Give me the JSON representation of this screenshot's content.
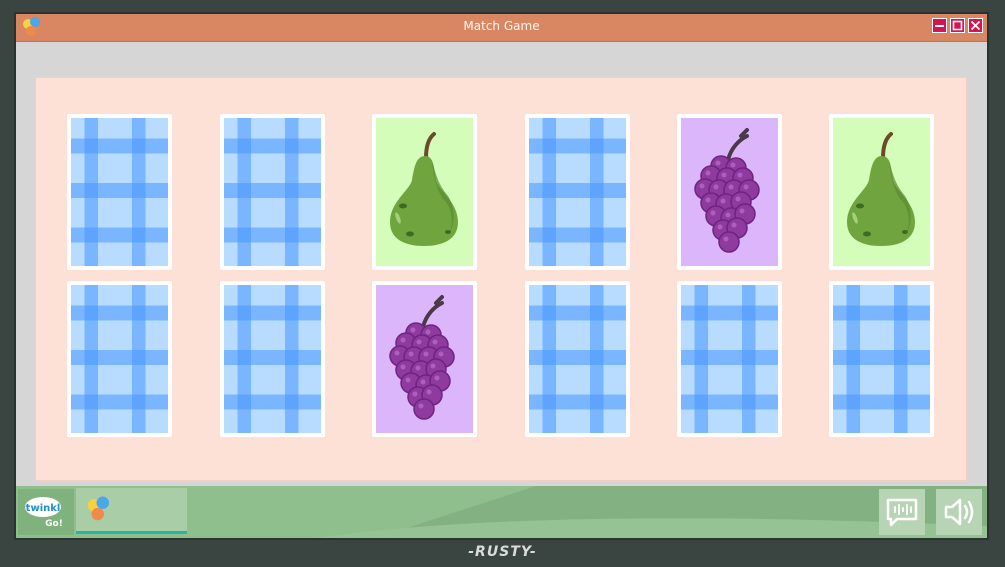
{
  "window": {
    "title": "Match Game"
  },
  "cards": [
    {
      "state": "face-down"
    },
    {
      "state": "face-down"
    },
    {
      "state": "face-up",
      "fruit": "pear-icon"
    },
    {
      "state": "face-down"
    },
    {
      "state": "face-up",
      "fruit": "grapes-icon"
    },
    {
      "state": "face-up",
      "fruit": "pear-icon"
    },
    {
      "state": "face-down"
    },
    {
      "state": "face-down"
    },
    {
      "state": "face-up",
      "fruit": "grapes-icon"
    },
    {
      "state": "face-down"
    },
    {
      "state": "face-down"
    },
    {
      "state": "face-down"
    }
  ],
  "taskbar": {
    "start_logo_line1": "twinkl",
    "start_logo_line2": "Go!",
    "tray": [
      "transcript-icon",
      "volume-icon"
    ]
  },
  "brand_label": "-RUSTY-",
  "colors": {
    "titlebar": "#d98762",
    "close_buttons": "#d6144f",
    "board": "#fde0d6",
    "pear_card": "#d3fdb8",
    "grapes_card": "#dcb6fb",
    "card_back": "#b8dcff",
    "taskbar": "#8fbf8c"
  }
}
